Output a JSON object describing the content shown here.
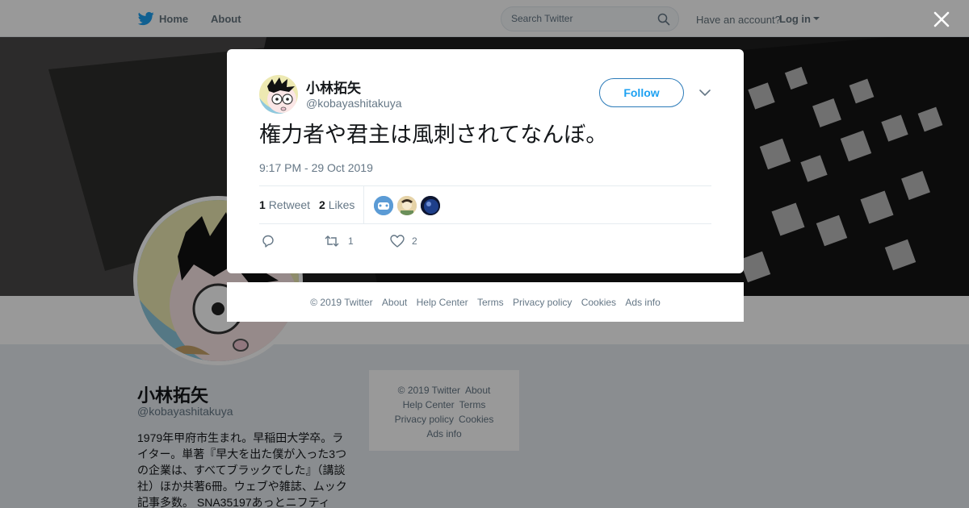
{
  "topbar": {
    "home_label": "Home",
    "about_label": "About",
    "search_placeholder": "Search Twitter",
    "account_question": "Have an account?",
    "login_label": "Log in"
  },
  "profile": {
    "name": "小林拓矢",
    "handle": "@kobayashitakuya",
    "bio": "1979年甲府市生まれ。早稲田大学卒。ライター。単著『早大を出た僕が入った3つの企業は、すべてブラックでした』（講談社）ほか共著6冊。ウェブや雑誌、ムック記事多数。 SNA35197あっとニフティ"
  },
  "side_footer": {
    "copyright": "© 2019 Twitter",
    "about": "About",
    "help": "Help Center",
    "terms": "Terms",
    "privacy": "Privacy policy",
    "cookies": "Cookies",
    "ads": "Ads info"
  },
  "tweet": {
    "author_name": "小林拓矢",
    "author_handle": "@kobayashitakuya",
    "follow_label": "Follow",
    "text": "権力者や君主は風刺されてなんぼ。",
    "timestamp": "9:17 PM - 29 Oct 2019",
    "retweet_count": "1",
    "retweet_label": "Retweet",
    "like_count": "2",
    "like_label": "Likes",
    "action_retweet_count": "1",
    "action_like_count": "2"
  },
  "modal_footer": {
    "copyright": "© 2019 Twitter",
    "about": "About",
    "help": "Help Center",
    "terms": "Terms",
    "privacy": "Privacy policy",
    "cookies": "Cookies",
    "ads": "Ads info"
  },
  "colors": {
    "brand_blue": "#1da1f2",
    "text_dark": "#14171a",
    "text_muted": "#657786"
  },
  "icons": [
    "twitter-bird-icon",
    "search-icon",
    "caret-down-icon",
    "close-icon",
    "reply-icon",
    "retweet-icon",
    "heart-icon"
  ]
}
